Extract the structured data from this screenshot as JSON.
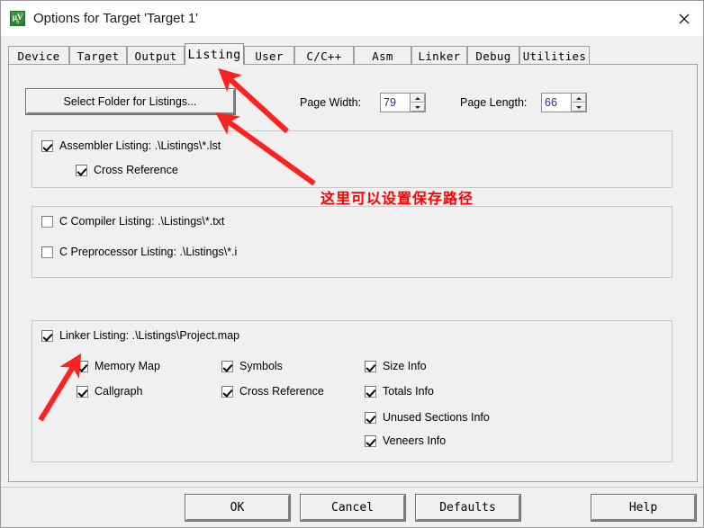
{
  "window": {
    "title": "Options for Target 'Target 1'",
    "icon_name": "uvision-icon",
    "icon_text": "µV",
    "icon_sub": "5",
    "close_label": "✕"
  },
  "tabs": [
    {
      "label": "Device",
      "active": false
    },
    {
      "label": "Target",
      "active": false
    },
    {
      "label": "Output",
      "active": false
    },
    {
      "label": "Listing",
      "active": true
    },
    {
      "label": "User",
      "active": false
    },
    {
      "label": "C/C++",
      "active": false
    },
    {
      "label": "Asm",
      "active": false
    },
    {
      "label": "Linker",
      "active": false
    },
    {
      "label": "Debug",
      "active": false
    },
    {
      "label": "Utilities",
      "active": false
    }
  ],
  "toolbar": {
    "select_folder_label": "Select Folder for Listings...",
    "page_width_label": "Page Width:",
    "page_width_value": "79",
    "page_length_label": "Page Length:",
    "page_length_value": "66"
  },
  "assembler_group": {
    "items": [
      {
        "label": "Assembler Listing:  .\\Listings\\*.lst",
        "checked": true
      },
      {
        "label": "Cross Reference",
        "checked": true
      }
    ]
  },
  "compiler_group": {
    "items": [
      {
        "label": "C Compiler Listing:  .\\Listings\\*.txt",
        "checked": false
      },
      {
        "label": "C Preprocessor Listing:  .\\Listings\\*.i",
        "checked": false
      }
    ]
  },
  "linker_group": {
    "header": {
      "label": "Linker Listing:  .\\Listings\\Project.map",
      "checked": true
    },
    "col1": [
      {
        "label": "Memory Map",
        "checked": true
      },
      {
        "label": "Callgraph",
        "checked": true
      }
    ],
    "col2": [
      {
        "label": "Symbols",
        "checked": true
      },
      {
        "label": "Cross Reference",
        "checked": true
      }
    ],
    "col3": [
      {
        "label": "Size Info",
        "checked": true
      },
      {
        "label": "Totals Info",
        "checked": true
      },
      {
        "label": "Unused Sections Info",
        "checked": true
      },
      {
        "label": "Veneers Info",
        "checked": true
      }
    ]
  },
  "footer": {
    "ok_label": "OK",
    "cancel_label": "Cancel",
    "defaults_label": "Defaults",
    "help_label": "Help"
  },
  "annotation": {
    "text": "这里可以设置保存路径",
    "color": "#ff0000"
  }
}
